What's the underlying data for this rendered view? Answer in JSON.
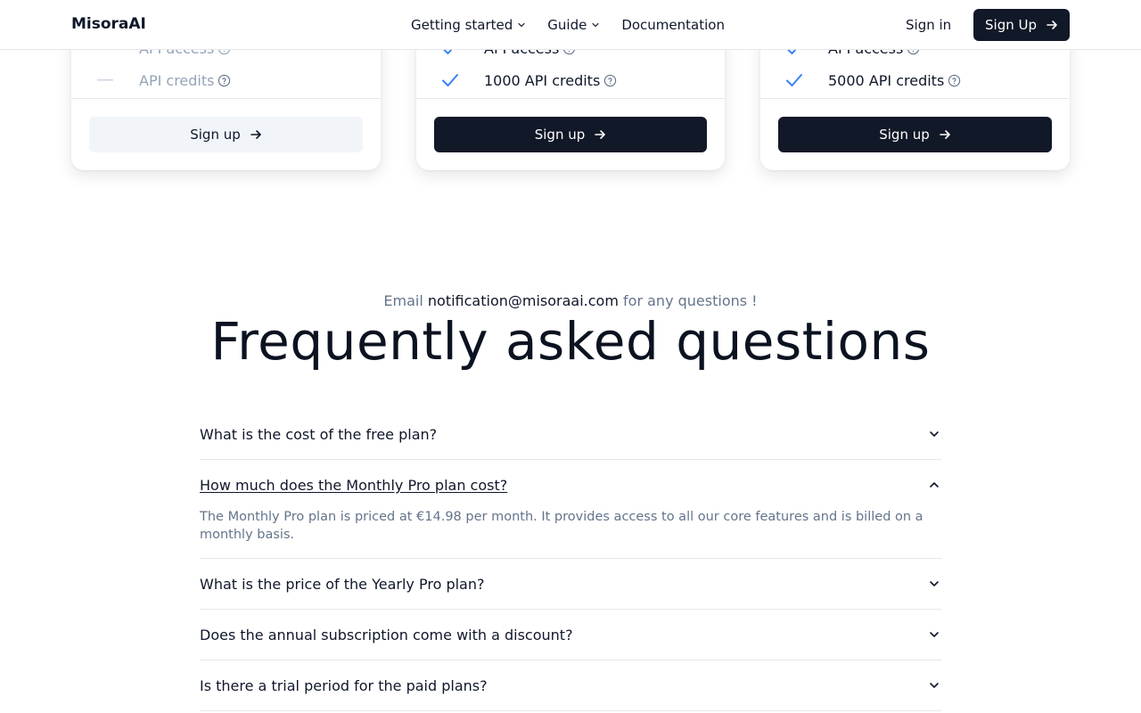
{
  "header": {
    "brand": "MisoraAI",
    "nav": [
      {
        "label": "Getting started",
        "has_dropdown": true
      },
      {
        "label": "Guide",
        "has_dropdown": true
      },
      {
        "label": "Documentation",
        "has_dropdown": false
      }
    ],
    "sign_in": "Sign in",
    "sign_up": "Sign Up"
  },
  "pricing_cards": [
    {
      "features": [
        {
          "label": "API access",
          "included": false
        },
        {
          "label": "API credits",
          "included": false
        }
      ],
      "button": "Sign up",
      "button_style": "light"
    },
    {
      "features": [
        {
          "label": "API access",
          "included": true
        },
        {
          "label": "1000 API credits",
          "included": true
        }
      ],
      "button": "Sign up",
      "button_style": "dark"
    },
    {
      "features": [
        {
          "label": "API access",
          "included": true
        },
        {
          "label": "5000 API credits",
          "included": true
        }
      ],
      "button": "Sign up",
      "button_style": "dark"
    }
  ],
  "faq": {
    "email_prefix": "Email",
    "email": "notification@misoraai.com",
    "email_suffix": "for any questions !",
    "title": "Frequently asked questions",
    "items": [
      {
        "question": "What is the cost of the free plan?",
        "open": false
      },
      {
        "question": "How much does the Monthly Pro plan cost?",
        "open": true,
        "answer": "The Monthly Pro plan is priced at €14.98 per month. It provides access to all our core features and is billed on a monthly basis."
      },
      {
        "question": "What is the price of the Yearly Pro plan?",
        "open": false
      },
      {
        "question": "Does the annual subscription come with a discount?",
        "open": false
      },
      {
        "question": "Is there a trial period for the paid plans?",
        "open": false
      }
    ]
  },
  "colors": {
    "primary_dark": "#111827",
    "check_blue": "#3b82f6",
    "muted_text": "#64748b",
    "border": "#e5e7eb"
  }
}
